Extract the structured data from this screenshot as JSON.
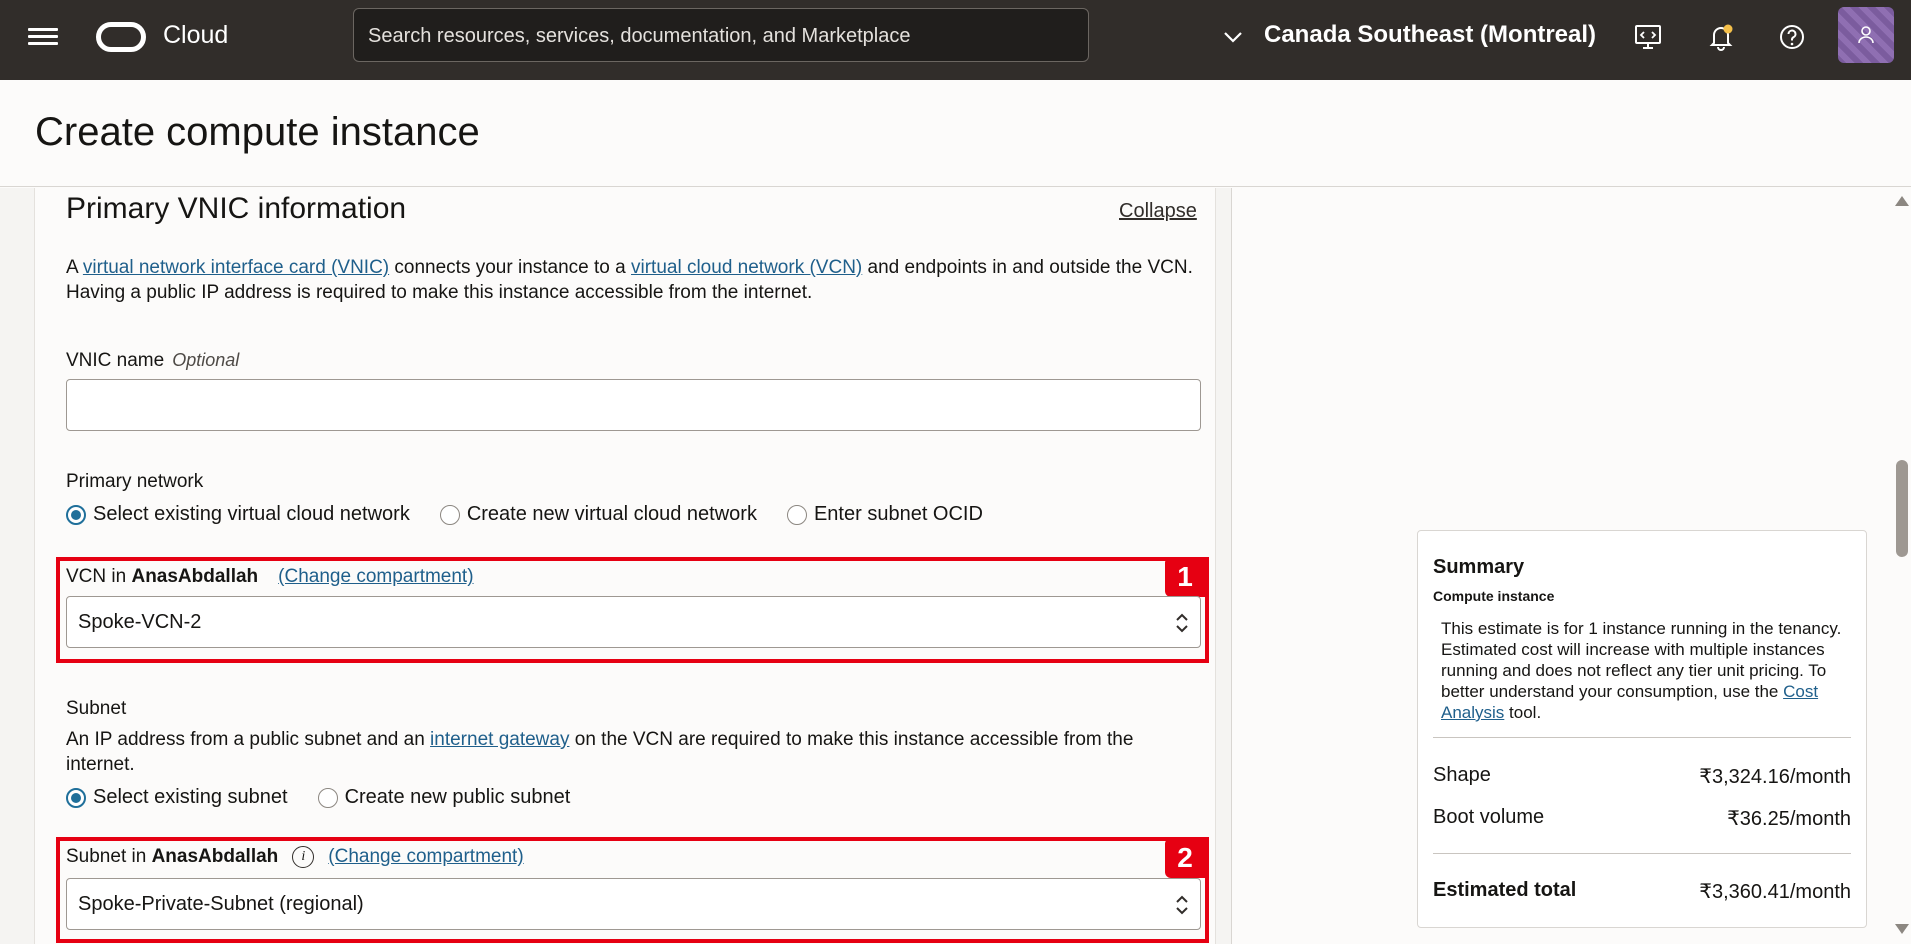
{
  "header": {
    "brand": "Cloud",
    "search_placeholder": "Search resources, services, documentation, and Marketplace",
    "region": "Canada Southeast (Montreal)"
  },
  "page": {
    "title": "Create compute instance"
  },
  "vnic_section": {
    "title": "Primary VNIC information",
    "collapse_label": "Collapse",
    "desc_part1": "A ",
    "desc_link1": "virtual network interface card (VNIC)",
    "desc_part2": " connects your instance to a ",
    "desc_link2": "virtual cloud network (VCN)",
    "desc_part3": " and endpoints in and outside the VCN. Having a public IP address is required to make this instance accessible from the internet.",
    "vnic_name_label": "VNIC name",
    "optional_label": "Optional",
    "vnic_name_value": "",
    "primary_network_label": "Primary network",
    "network_options": [
      {
        "label": "Select existing virtual cloud network",
        "checked": true
      },
      {
        "label": "Create new virtual cloud network",
        "checked": false
      },
      {
        "label": "Enter subnet OCID",
        "checked": false
      }
    ],
    "vcn_label_prefix": "VCN in ",
    "vcn_compartment": "AnasAbdallah",
    "change_compartment": "(Change compartment)",
    "vcn_value": "Spoke-VCN-2",
    "badge1": "1",
    "subnet_label": "Subnet",
    "subnet_desc_part1": "An IP address from a public subnet and an ",
    "subnet_desc_link": "internet gateway",
    "subnet_desc_part2": " on the VCN are required to make this instance accessible from the internet.",
    "subnet_options": [
      {
        "label": "Select existing subnet",
        "checked": true
      },
      {
        "label": "Create new public subnet",
        "checked": false
      }
    ],
    "subnet_in_prefix": "Subnet in ",
    "subnet_compartment": "AnasAbdallah",
    "subnet_change_compartment": "(Change compartment)",
    "subnet_value": "Spoke-Private-Subnet (regional)",
    "badge2": "2"
  },
  "summary": {
    "title": "Summary",
    "subtitle": "Compute instance",
    "desc_part1": "This estimate is for 1 instance running in the tenancy. Estimated cost will increase with multiple instances running and does not reflect any tier unit pricing. To better understand your consumption, use the ",
    "desc_link": "Cost Analysis",
    "desc_part2": " tool.",
    "rows": [
      {
        "key": "Shape",
        "value": "₹3,324.16/month"
      },
      {
        "key": "Boot volume",
        "value": "₹36.25/month"
      }
    ],
    "total_key": "Estimated total",
    "total_value": "₹3,360.41/month"
  },
  "colors": {
    "topbar": "#312d2a",
    "link": "#1f5f8b",
    "highlight": "#e60012",
    "radio": "#1f6f9a"
  }
}
